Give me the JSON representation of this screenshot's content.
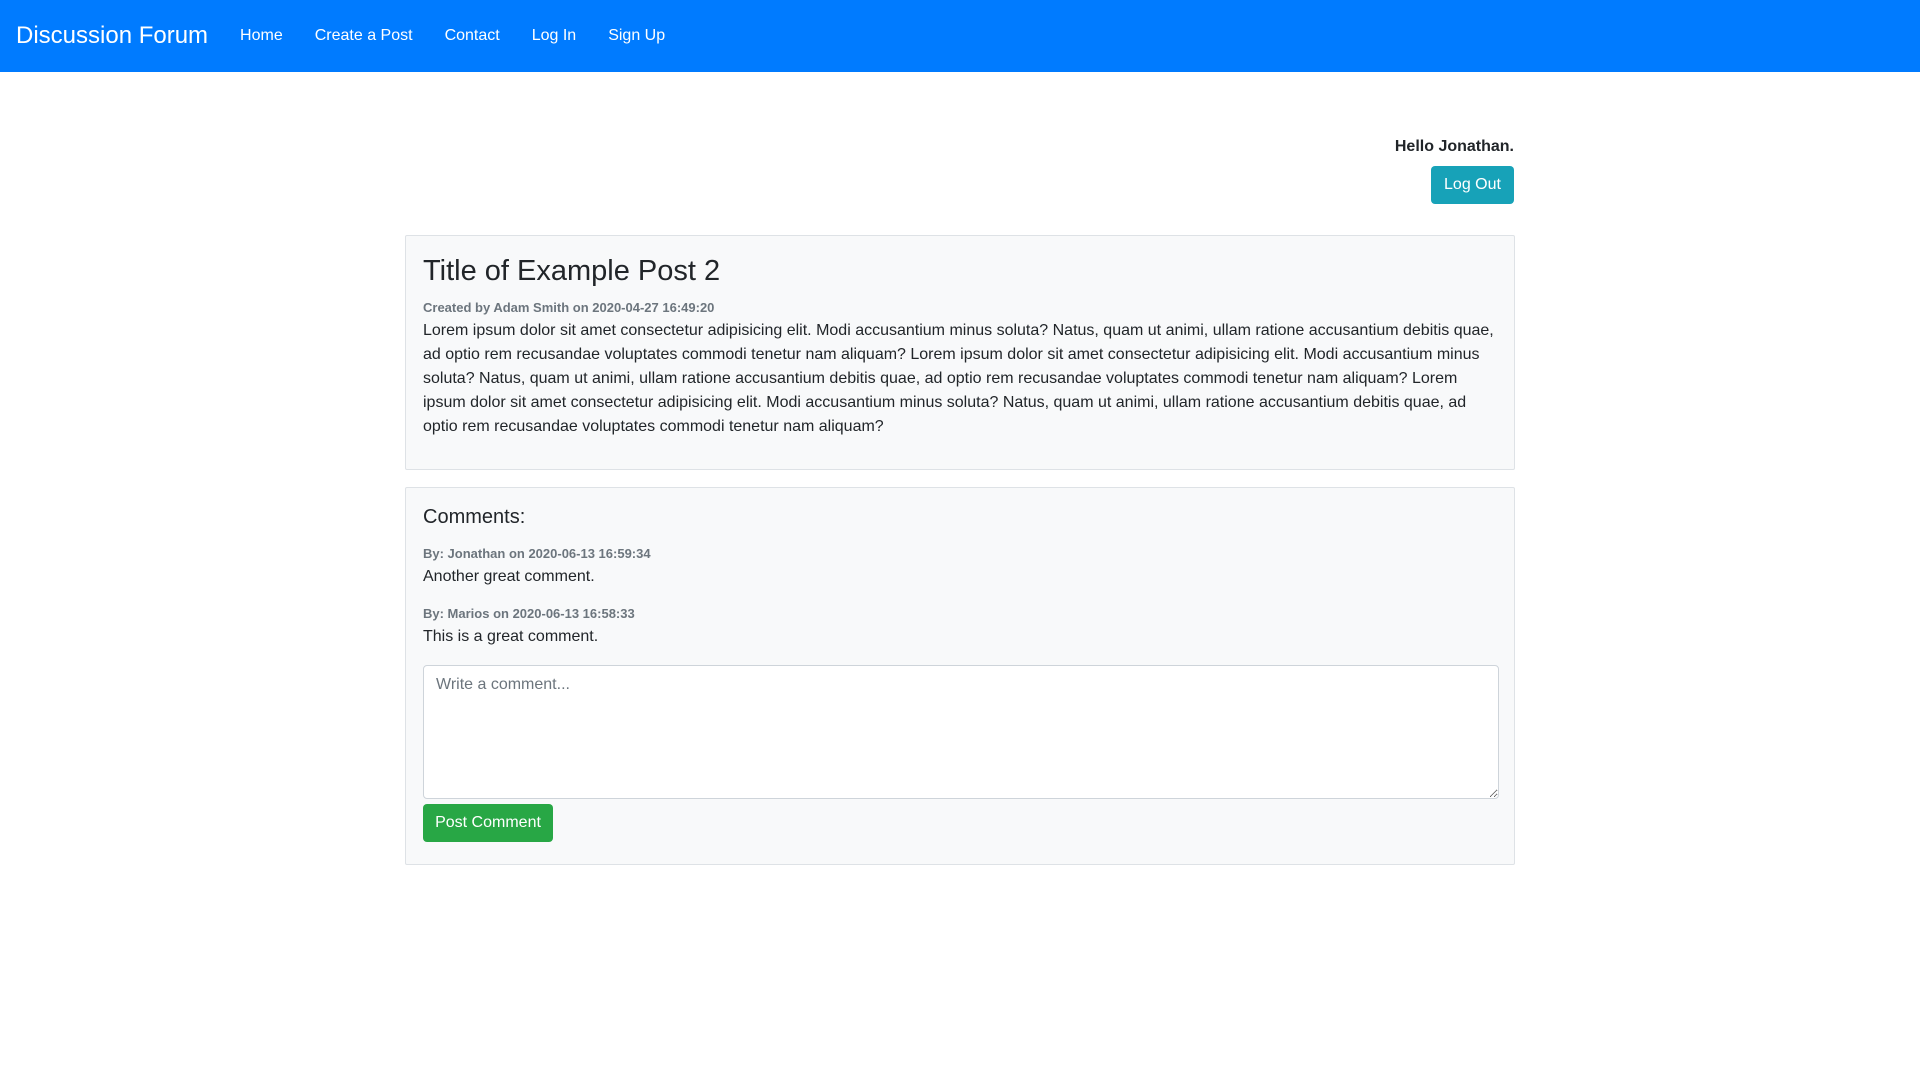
{
  "navbar": {
    "brand": "Discussion Forum",
    "links": [
      {
        "label": "Home"
      },
      {
        "label": "Create a Post"
      },
      {
        "label": "Contact"
      },
      {
        "label": "Log In"
      },
      {
        "label": "Sign Up"
      }
    ],
    "background": "#007bff"
  },
  "user": {
    "greeting": "Hello Jonathan.",
    "logout_label": "Log Out",
    "logout_color": "#17a2b8"
  },
  "post": {
    "title": "Title of Example Post 2",
    "meta": "Created by Adam Smith on 2020-04-27 16:49:20",
    "body": "Lorem ipsum dolor sit amet consectetur adipisicing elit. Modi accusantium minus soluta? Natus, quam ut animi, ullam ratione accusantium debitis quae, ad optio rem recusandae voluptates commodi tenetur nam aliquam? Lorem ipsum dolor sit amet consectetur adipisicing elit. Modi accusantium minus soluta? Natus, quam ut animi, ullam ratione accusantium debitis quae, ad optio rem recusandae voluptates commodi tenetur nam aliquam? Lorem ipsum dolor sit amet consectetur adipisicing elit. Modi accusantium minus soluta? Natus, quam ut animi, ullam ratione accusantium debitis quae, ad optio rem recusandae voluptates commodi tenetur nam aliquam?"
  },
  "comments": {
    "heading": "Comments:",
    "items": [
      {
        "meta": "By: Jonathan on 2020-06-13 16:59:34",
        "text": "Another great comment."
      },
      {
        "meta": "By: Marios on 2020-06-13 16:58:33",
        "text": "This is a great comment."
      }
    ],
    "input_value": "",
    "input_placeholder": "Write a comment...",
    "submit_label": "Post Comment",
    "submit_color": "#28a745"
  }
}
